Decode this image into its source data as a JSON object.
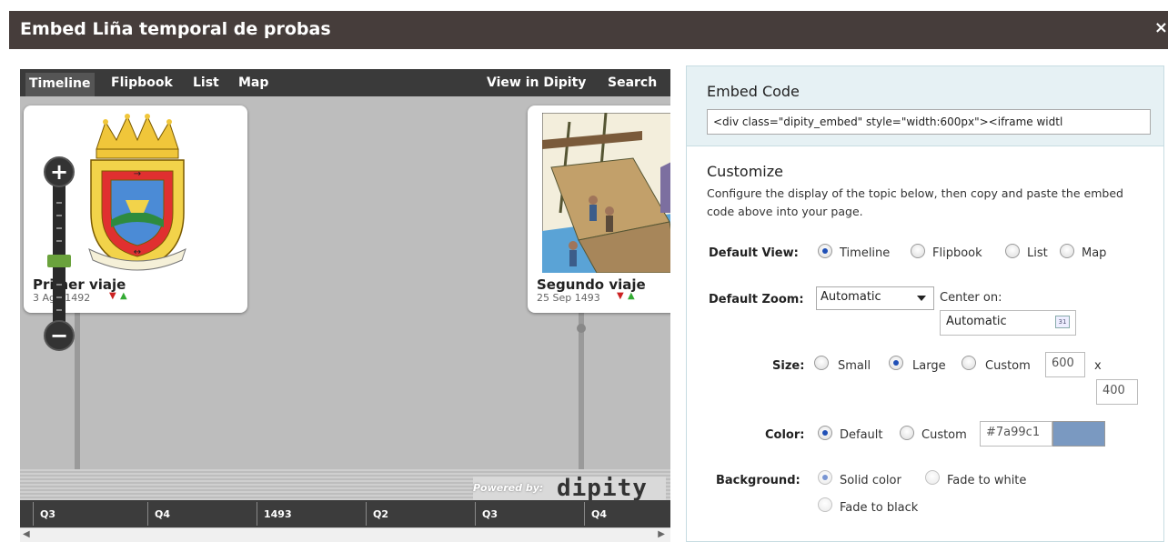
{
  "window": {
    "title": "Embed Liña temporal de probas",
    "close_label": "×"
  },
  "preview": {
    "tabs": [
      {
        "label": "Timeline"
      },
      {
        "label": "Flipbook"
      },
      {
        "label": "List"
      },
      {
        "label": "Map"
      }
    ],
    "view_in_dipity": "View in Dipity",
    "search": "Search",
    "events": [
      {
        "title": "Primer viaje",
        "date": "3 Ago 1492"
      },
      {
        "title": "Segundo viaje",
        "date": "25 Sep 1493"
      }
    ],
    "zoom": {
      "in_label": "+",
      "out_label": "−"
    },
    "powered_by": "Powered by:",
    "logo": "dipity",
    "scale_labels": [
      "Q3",
      "Q4",
      "1493",
      "Q2",
      "Q3",
      "Q4"
    ]
  },
  "embed": {
    "label": "Embed Code",
    "code": "<div class=\"dipity_embed\" style=\"width:600px\"><iframe widtl"
  },
  "customize": {
    "title": "Customize",
    "description": "Configure the display of the topic below, then copy and paste the embed code above into your page.",
    "default_view": {
      "label": "Default View:",
      "options": [
        "Timeline",
        "Flipbook",
        "List",
        "Map"
      ],
      "selected": "Timeline"
    },
    "default_zoom": {
      "label": "Default Zoom:",
      "value": "Automatic"
    },
    "center_on": {
      "label": "Center on:",
      "value": "Automatic"
    },
    "size": {
      "label": "Size:",
      "options": [
        "Small",
        "Large",
        "Custom"
      ],
      "selected": "Large",
      "width": "600",
      "separator": "x",
      "height": "400"
    },
    "color": {
      "label": "Color:",
      "options": [
        "Default",
        "Custom"
      ],
      "selected": "Default",
      "hex": "#7a99c1"
    },
    "background": {
      "label": "Background:",
      "options": [
        "Solid color",
        "Fade to white",
        "Fade to black"
      ],
      "selected": "Solid color"
    }
  }
}
